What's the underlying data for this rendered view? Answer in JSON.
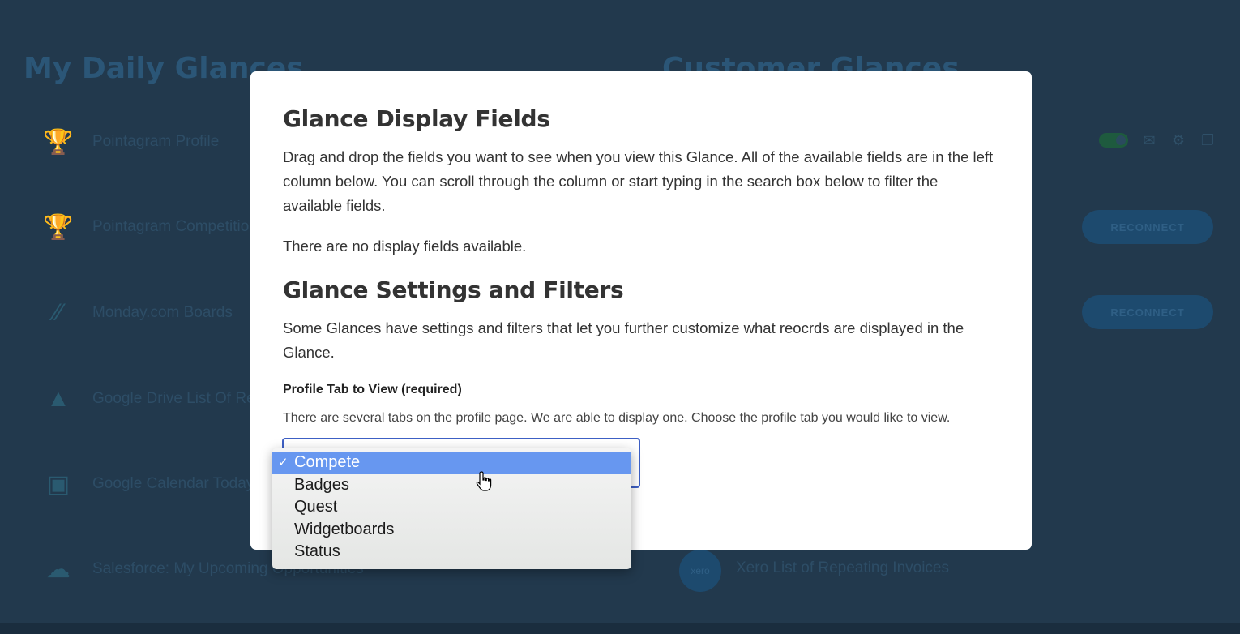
{
  "background": {
    "left_title": "My Daily Glances",
    "right_title": "Customer Glances",
    "glances": [
      {
        "name": "Pointagram Profile",
        "icon": "trophy-icon"
      },
      {
        "name": "Pointagram Competitio",
        "icon": "trophy-icon"
      },
      {
        "name": "Monday.com Boards",
        "icon": "monday-logo-icon"
      },
      {
        "name": "Google Drive List Of Re",
        "icon": "google-drive-icon"
      },
      {
        "name": "Google Calendar Today",
        "icon": "calendar-icon"
      },
      {
        "name": "Salesforce: My Upcoming Opportunities",
        "icon": "salesforce-cloud-icon"
      }
    ],
    "reconnect_label": "RECONNECT",
    "xero_label": "xero",
    "right_row": "Xero List of Repeating Invoices"
  },
  "modal": {
    "display_title": "Glance Display Fields",
    "display_description": "Drag and drop the fields you want to see when you view this Glance. All of the available fields are in the left column below. You can scroll through the column or start typing in the search box below to filter the available fields.",
    "no_fields": "There are no display fields available.",
    "settings_title": "Glance Settings and Filters",
    "settings_description": "Some Glances have settings and filters that let you further customize what reocrds are displayed in the Glance.",
    "field_label": "Profile Tab to View (required)",
    "field_help": "There are several tabs on the profile page. We are able to display one. Choose the profile tab you would like to view."
  },
  "dropdown": {
    "selected": "Compete",
    "check_mark": "✓",
    "options": [
      "Compete",
      "Badges",
      "Quest",
      "Widgetboards",
      "Status"
    ]
  }
}
